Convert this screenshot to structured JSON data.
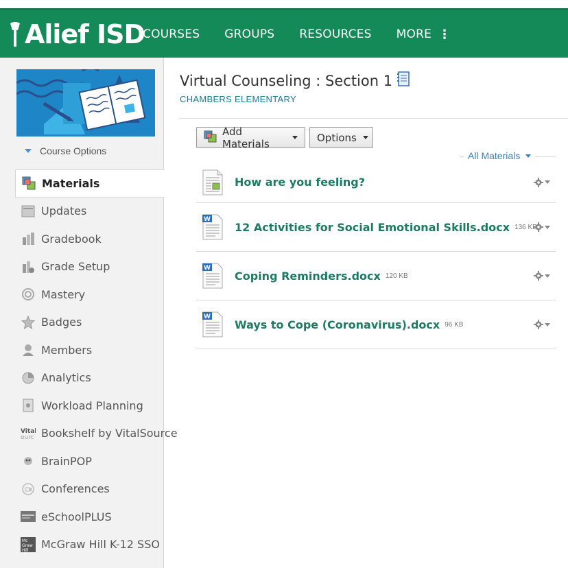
{
  "header": {
    "logo_text": "Alief ISD",
    "nav": [
      {
        "label": "COURSES"
      },
      {
        "label": "GROUPS"
      },
      {
        "label": "RESOURCES"
      },
      {
        "label": "MORE"
      }
    ],
    "more_dots": "⋮"
  },
  "sidebar": {
    "course_options_label": "Course Options",
    "items": [
      {
        "label": "Materials",
        "icon": "materials-icon"
      },
      {
        "label": "Updates",
        "icon": "updates-icon"
      },
      {
        "label": "Gradebook",
        "icon": "gradebook-icon"
      },
      {
        "label": "Grade Setup",
        "icon": "grade-setup-icon"
      },
      {
        "label": "Mastery",
        "icon": "mastery-icon"
      },
      {
        "label": "Badges",
        "icon": "badges-icon"
      },
      {
        "label": "Members",
        "icon": "members-icon"
      },
      {
        "label": "Analytics",
        "icon": "analytics-icon"
      },
      {
        "label": "Workload Planning",
        "icon": "workload-planning-icon"
      },
      {
        "label": "Bookshelf by VitalSource",
        "icon": "vitalsource-icon"
      },
      {
        "label": "BrainPOP",
        "icon": "brainpop-icon"
      },
      {
        "label": "Conferences",
        "icon": "conferences-icon"
      },
      {
        "label": "eSchoolPLUS",
        "icon": "eschoolplus-icon"
      },
      {
        "label": "McGraw Hill K-12 SSO",
        "icon": "mcgraw-hill-icon"
      }
    ]
  },
  "main": {
    "title": "Virtual Counseling : Section 1",
    "subtitle": "CHAMBERS ELEMENTARY",
    "add_materials_label": "Add Materials",
    "options_label": "Options",
    "filter_label": "All Materials",
    "materials": [
      {
        "title": "How are you feeling?",
        "size": "",
        "type": "page"
      },
      {
        "title": "12 Activities for Social Emotional Skills.docx",
        "size": "136 KB",
        "type": "word"
      },
      {
        "title": "Coping Reminders.docx",
        "size": "120 KB",
        "type": "word"
      },
      {
        "title": "Ways to Cope (Coronavirus).docx",
        "size": "96 KB",
        "type": "word"
      }
    ]
  },
  "colors": {
    "nav_green": "#138a57",
    "link_green": "#1e7a63",
    "link_blue": "#3a7fb8",
    "sidebar_bg": "#f2f2f2"
  }
}
